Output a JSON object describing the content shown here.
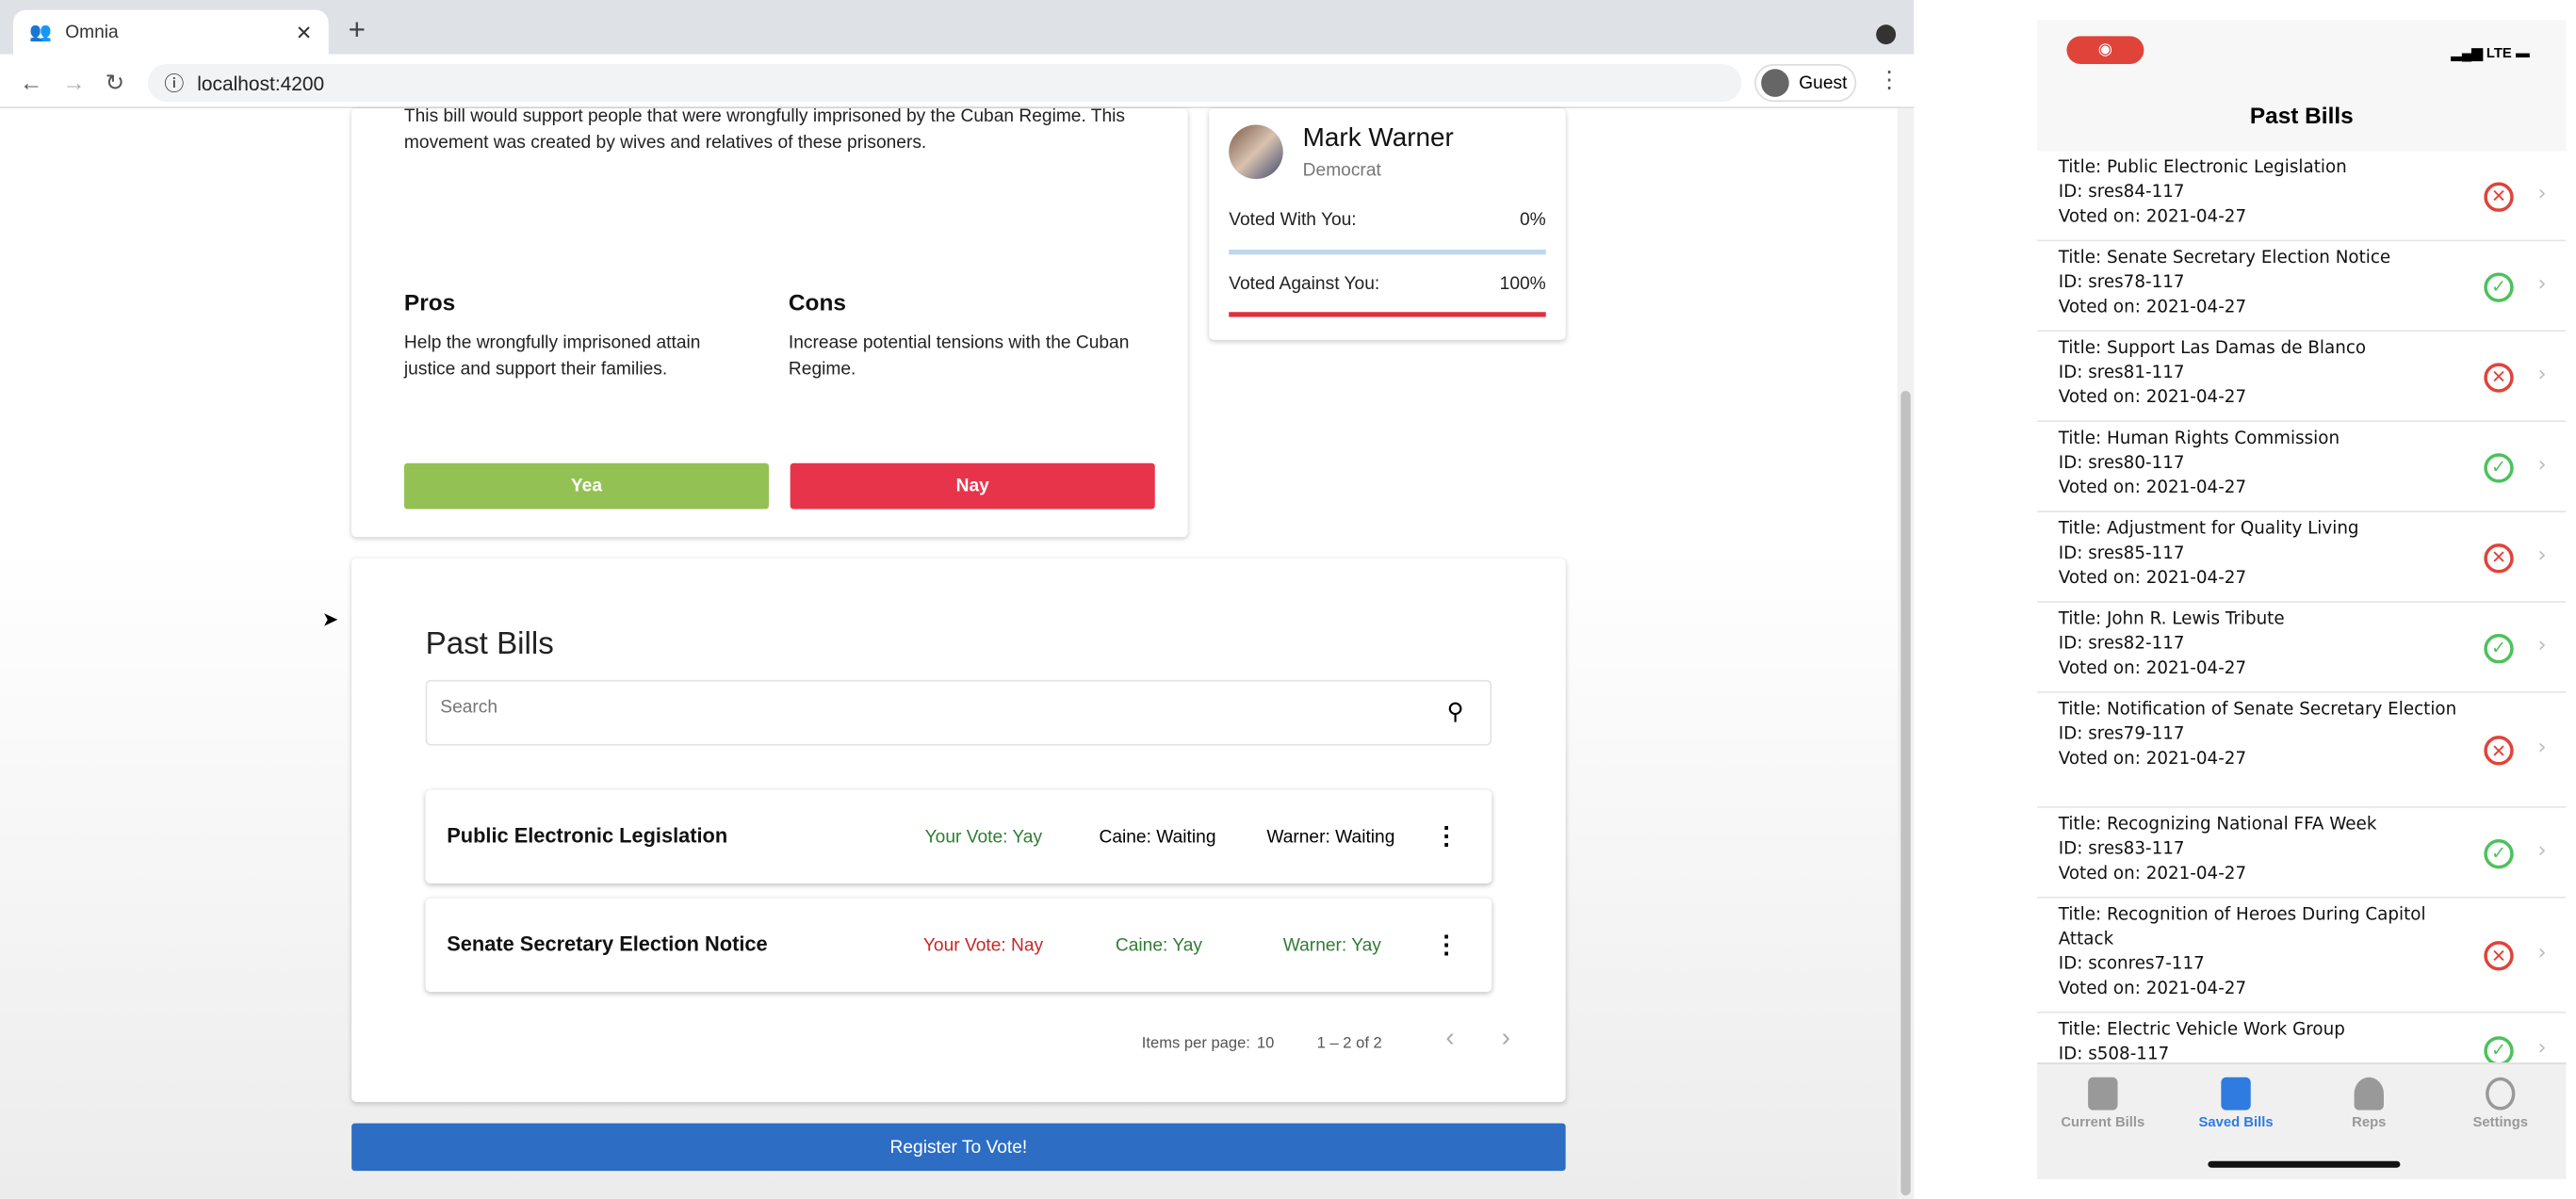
{
  "browser": {
    "tab_title": "Omnia",
    "url": "localhost:4200",
    "profile": "Guest"
  },
  "bill": {
    "description": "This bill would support people that were wrongfully imprisoned by the Cuban Regime. This movement was created by wives and relatives of these prisoners.",
    "pros_label": "Pros",
    "pros": "Help the wrongfully imprisoned attain justice and support their families.",
    "cons_label": "Cons",
    "cons": "Increase potential tensions with the Cuban Regime.",
    "yea": "Yea",
    "nay": "Nay"
  },
  "rep": {
    "name": "Mark Warner",
    "party": "Democrat",
    "with_label": "Voted With You:",
    "with_value": "0%",
    "with_fraction": 0,
    "against_label": "Voted Against You:",
    "against_value": "100%",
    "against_fraction": 1
  },
  "past_bills": {
    "title": "Past Bills",
    "search_placeholder": "Search",
    "rows": [
      {
        "title": "Public Electronic Legislation",
        "your_vote": "Your Vote: Yay",
        "caine": "Caine: Waiting",
        "warner": "Warner: Waiting"
      },
      {
        "title": "Senate Secretary Election Notice",
        "your_vote": "Your Vote: Nay",
        "caine": "Caine: Yay",
        "warner": "Warner: Yay"
      }
    ],
    "items_per_page_label": "Items per page:",
    "items_per_page": "10",
    "range": "1 – 2 of 2"
  },
  "register": "Register To Vote!",
  "phone": {
    "carrier": "LTE",
    "title": "Past Bills",
    "items": [
      {
        "title": "Title: Public Electronic Legislation",
        "id": "ID: sres84-117",
        "date": "Voted on: 2021-04-27",
        "vote": "nay"
      },
      {
        "title": "Title: Senate Secretary Election Notice",
        "id": "ID: sres78-117",
        "date": "Voted on: 2021-04-27",
        "vote": "yea"
      },
      {
        "title": "Title: Support Las Damas de Blanco",
        "id": "ID: sres81-117",
        "date": "Voted on: 2021-04-27",
        "vote": "nay"
      },
      {
        "title": "Title: Human Rights Commission",
        "id": "ID: sres80-117",
        "date": "Voted on: 2021-04-27",
        "vote": "yea"
      },
      {
        "title": "Title: Adjustment for Quality Living",
        "id": "ID: sres85-117",
        "date": "Voted on: 2021-04-27",
        "vote": "nay"
      },
      {
        "title": "Title: John R. Lewis Tribute",
        "id": "ID: sres82-117",
        "date": "Voted on: 2021-04-27",
        "vote": "yea"
      },
      {
        "title": "Title: Notification of Senate Secretary Election",
        "id": "ID: sres79-117",
        "date": "Voted on: 2021-04-27",
        "vote": "nay"
      },
      {
        "title": "Title: Recognizing National FFA Week",
        "id": "ID: sres83-117",
        "date": "Voted on: 2021-04-27",
        "vote": "yea"
      },
      {
        "title": "Title: Recognition of Heroes During Capitol Attack",
        "id": "ID: sconres7-117",
        "date": "Voted on: 2021-04-27",
        "vote": "nay"
      },
      {
        "title": "Title: Electric Vehicle Work Group",
        "id": "ID: s508-117",
        "date": "",
        "vote": "yea"
      }
    ],
    "tabs": [
      "Current Bills",
      "Saved Bills",
      "Reps",
      "Settings"
    ],
    "active_tab": "Saved Bills"
  },
  "colors": {
    "yea": "#94c154",
    "nay": "#e8344b",
    "register": "#2d6ec4",
    "active_tab": "#2f7be0"
  }
}
